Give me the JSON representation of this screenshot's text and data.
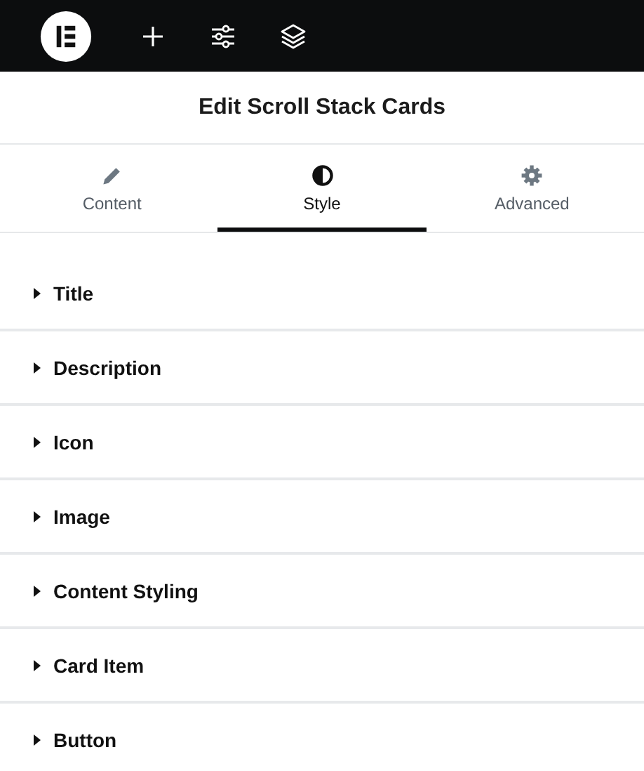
{
  "toolbar": {
    "buttons": [
      {
        "kind": "logo"
      },
      {
        "kind": "add"
      },
      {
        "kind": "settings"
      },
      {
        "kind": "layers"
      }
    ]
  },
  "panel": {
    "title": "Edit Scroll Stack Cards"
  },
  "tabs": [
    {
      "label": "Content",
      "kind": "pencil",
      "selected": false
    },
    {
      "label": "Style",
      "kind": "contrast",
      "selected": true
    },
    {
      "label": "Advanced",
      "kind": "gear",
      "selected": false
    }
  ],
  "sections": [
    {
      "label": "Title",
      "expanded": false
    },
    {
      "label": "Description",
      "expanded": false
    },
    {
      "label": "Icon",
      "expanded": false
    },
    {
      "label": "Image",
      "expanded": false
    },
    {
      "label": "Content Styling",
      "expanded": false
    },
    {
      "label": "Card Item",
      "expanded": false
    },
    {
      "label": "Button",
      "expanded": false
    }
  ]
}
